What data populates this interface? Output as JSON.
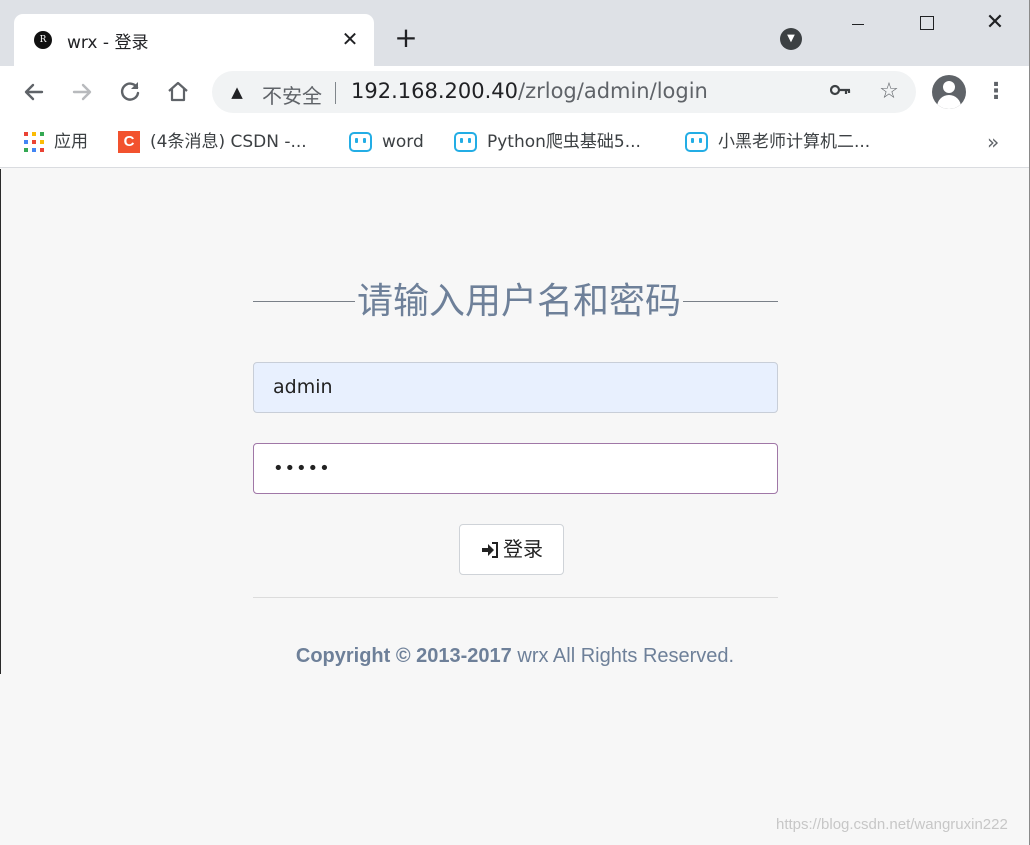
{
  "window": {
    "tab_title": "wrx - 登录",
    "favicon_letter": "R",
    "new_tab": "+",
    "close_tab": "✕"
  },
  "toolbar": {
    "security_label": "不安全",
    "url_host": "192.168.200.40",
    "url_path": "/zrlog/admin/login"
  },
  "bookmarks": {
    "items": [
      {
        "label": "应用",
        "icon": "apps-grid-icon"
      },
      {
        "label": "(4条消息) CSDN -...",
        "icon": "csdn-icon"
      },
      {
        "label": "word",
        "icon": "bilibili-icon"
      },
      {
        "label": "Python爬虫基础5...",
        "icon": "bilibili-icon"
      },
      {
        "label": "小黑老师计算机二...",
        "icon": "bilibili-icon"
      }
    ],
    "more": "»"
  },
  "login": {
    "heading": "请输入用户名和密码",
    "username_value": "admin",
    "password_mask": "•••••",
    "submit_label": "登录"
  },
  "footer": {
    "copyright_prefix": "Copyright © 2013-2017",
    "copyright_suffix": " wrx All Rights Reserved."
  },
  "watermark": "https://blog.csdn.net/wangruxin222",
  "colors": {
    "titlebar": "#dee1e6",
    "page_bg": "#f7f7f7",
    "heading": "#6e8099",
    "autofill_bg": "#e8f0fe",
    "focus_border": "#a077a7",
    "bilibili_blue": "#23ade5",
    "csdn_red": "#f2522e"
  }
}
